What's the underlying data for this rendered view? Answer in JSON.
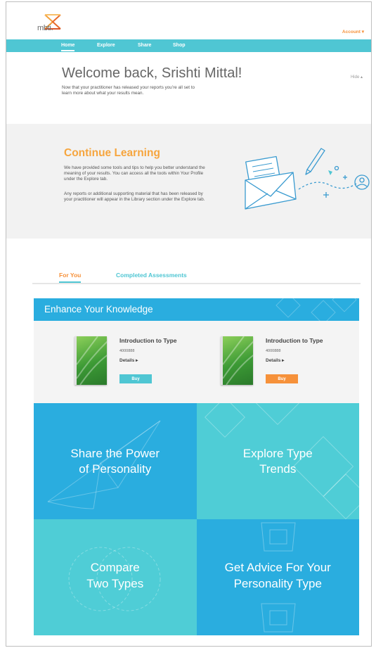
{
  "header": {
    "logo_text": "mbti.",
    "account_label": "Account ▾"
  },
  "nav": {
    "items": [
      {
        "label": "Home"
      },
      {
        "label": "Explore"
      },
      {
        "label": "Share"
      },
      {
        "label": "Shop"
      }
    ],
    "active": "Home"
  },
  "welcome": {
    "title": "Welcome back, Srishti Mittal!",
    "message": "Now that your practitioner has released your reports you’re all set to learn more about what your results mean.",
    "hide_label": "Hide ▴"
  },
  "continue_learning": {
    "title": "Continue Learning",
    "paragraph1": "We have provided some tools and tips to help you better understand the meaning of your results. You can access all the tools within Your Profile under the Explore tab.",
    "paragraph2": "Any reports or additional supporting material that has been released by your practitioner will appear in the Library section under the Explore tab."
  },
  "tabs": [
    {
      "label": "For You"
    },
    {
      "label": "Completed Assessments"
    }
  ],
  "enhance": {
    "title": "Enhance Your Knowledge",
    "products": [
      {
        "name": "Introduction to Type",
        "code": "4000888",
        "details_label": "Details ▸",
        "buy_label": "Buy",
        "buy_color": "#4fc6d3"
      },
      {
        "name": "Introduction to Type",
        "code": "4000888",
        "details_label": "Details ▸",
        "buy_label": "Buy",
        "buy_color": "#f6913a"
      }
    ]
  },
  "tiles": [
    {
      "line1": "Share the Power",
      "line2": "of Personality",
      "color": "#2aaddf"
    },
    {
      "line1": "Explore Type",
      "line2": "Trends",
      "color": "#4fcdd6"
    },
    {
      "line1": "Compare",
      "line2": "Two Types",
      "color": "#4fcdd6"
    },
    {
      "line1": "Get Advice For Your",
      "line2": "Personality Type",
      "color": "#2aaddf"
    }
  ],
  "colors": {
    "teal": "#4fc6d3",
    "blue": "#2aaddf",
    "orange": "#f6913a"
  }
}
